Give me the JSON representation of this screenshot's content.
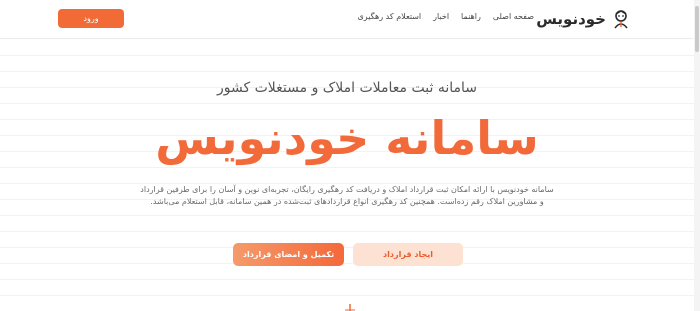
{
  "header": {
    "logo_text": "خودنویس",
    "nav": [
      "صفحه اصلی",
      "راهنما",
      "اخبار",
      "استعلام کد رهگیری"
    ],
    "login_label": "ورود"
  },
  "hero": {
    "subtitle": "سامانه ثبت معاملات املاک و مستغلات کشور",
    "title": "سامانه خودنویس",
    "description": "سامانه خودنویس با ارائه امکان ثبت قرارداد املاک و دریافت کد رهگیری رایگان، تجربه‌ای نوین و آسان را برای طرفین قرارداد و مشاورین املاک رقم زده‌است. همچنین کد رهگیری انواع قراردادهای ثبت‌شده در همین سامانه، قابل استعلام می‌باشد.",
    "primary_button": "تکمیل و امضای قرارداد",
    "secondary_button": "ایجاد قرارداد"
  },
  "colors": {
    "accent": "#f2693a",
    "accent_light": "#fde1d3"
  },
  "icons": {
    "logo": "pen-person-icon"
  }
}
